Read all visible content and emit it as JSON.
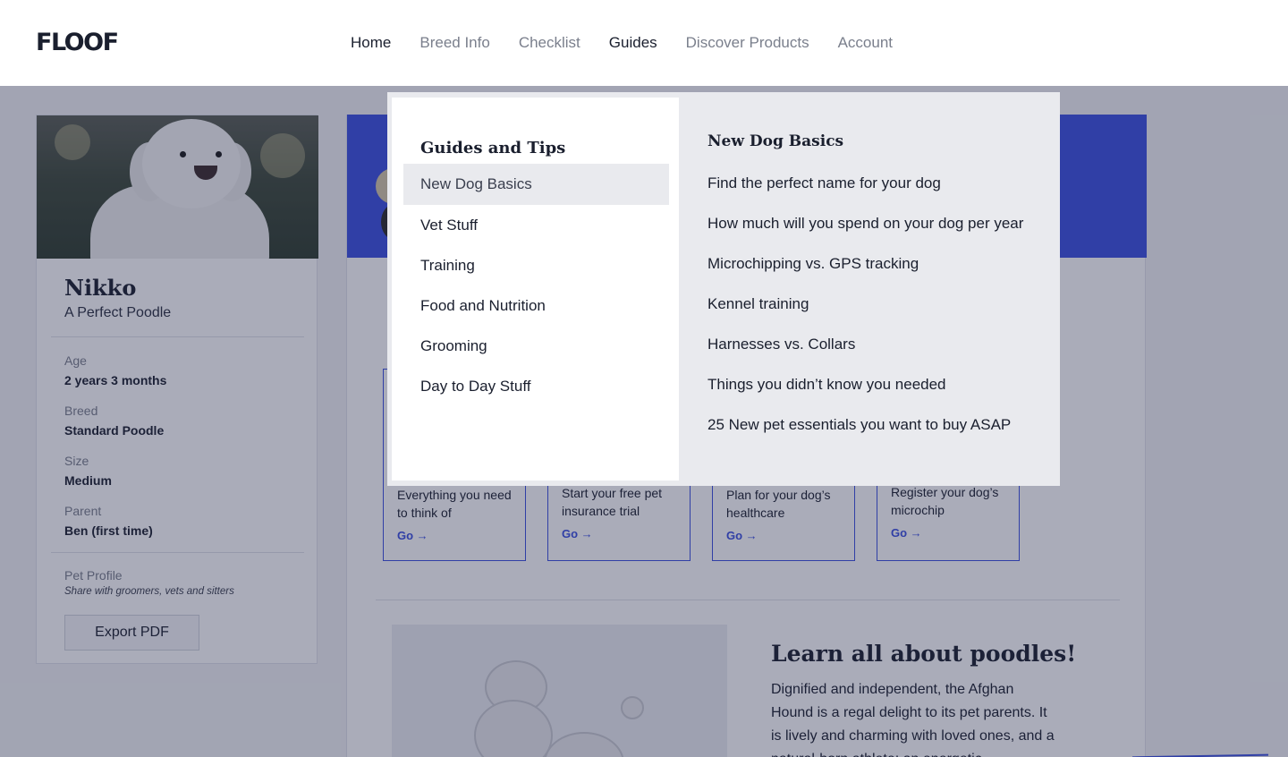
{
  "header": {
    "logo": "FLOOF",
    "nav": [
      {
        "label": "Home"
      },
      {
        "label": "Breed Info"
      },
      {
        "label": "Checklist"
      },
      {
        "label": "Guides"
      },
      {
        "label": "Discover Products"
      },
      {
        "label": "Account"
      }
    ]
  },
  "profile": {
    "name": "Nikko",
    "subtitle": "A Perfect Poodle",
    "fields": [
      {
        "label": "Age",
        "value": "2 years 3 months"
      },
      {
        "label": "Breed",
        "value": "Standard Poodle"
      },
      {
        "label": "Size",
        "value": "Medium"
      },
      {
        "label": "Parent",
        "value": "Ben (first time)"
      }
    ],
    "pet_profile_label": "Pet Profile",
    "pet_profile_note": "Share with groomers, vets and sitters",
    "export_label": "Export PDF"
  },
  "cards": [
    {
      "text": "Everything you need to think of",
      "go": "Go →"
    },
    {
      "text": "Start your free pet insurance trial",
      "go": "Go →"
    },
    {
      "text": "Plan for your dog’s healthcare",
      "go": "Go →"
    },
    {
      "text": "Register your dog’s microchip",
      "go": "Go →"
    }
  ],
  "learn": {
    "title": "Learn all about poodles!",
    "text": "Dignified and independent, the Afghan Hound is a regal delight to its pet parents. It is lively and charming with loved ones, and a natural-born athlete; an energetic"
  },
  "dropdown": {
    "heading": "Guides and Tips",
    "categories": [
      {
        "label": "New Dog Basics"
      },
      {
        "label": "Vet Stuff"
      },
      {
        "label": "Training"
      },
      {
        "label": "Food and Nutrition"
      },
      {
        "label": "Grooming"
      },
      {
        "label": "Day to Day Stuff"
      }
    ],
    "selected_heading": "New Dog Basics",
    "links": [
      {
        "label": "Find the perfect name for your dog"
      },
      {
        "label": "How much will you spend on your dog per year"
      },
      {
        "label": "Microchipping vs. GPS tracking"
      },
      {
        "label": "Kennel training"
      },
      {
        "label": "Harnesses vs. Collars"
      },
      {
        "label": "Things you didn’t know you needed"
      },
      {
        "label": "25 New pet essentials you want to buy ASAP"
      }
    ]
  },
  "colors": {
    "accent": "#3b4fe0",
    "text": "#1a1f2e",
    "muted": "#7a7f8c"
  }
}
